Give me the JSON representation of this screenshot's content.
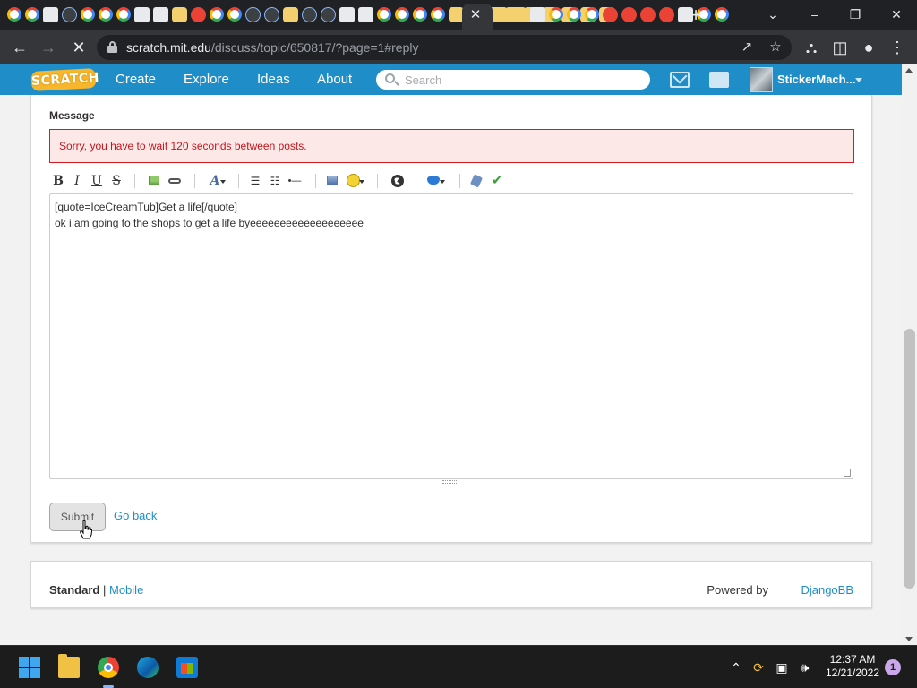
{
  "browser": {
    "tab_close_glyph": "✕",
    "new_tab_glyph": "+",
    "url_host": "scratch.mit.edu",
    "url_path": "/discuss/topic/650817/?page=1#reply",
    "tab_favicons": [
      "g",
      "g",
      "w",
      "b",
      "g",
      "g",
      "g",
      "w",
      "w",
      "y",
      "r",
      "g",
      "g",
      "b",
      "b",
      "y",
      "b",
      "b",
      "w",
      "w",
      "g",
      "g",
      "g",
      "g",
      "y",
      "y",
      "y",
      "y",
      "y",
      "y",
      "y",
      "y",
      "y"
    ],
    "tab_favicons_right": [
      "y",
      "y",
      "w",
      "g",
      "g",
      "g",
      "r",
      "r",
      "r",
      "r",
      "w",
      "g",
      "g"
    ]
  },
  "scratch_nav": {
    "logo_text": "SCRATCH",
    "links": [
      "Create",
      "Explore",
      "Ideas",
      "About"
    ],
    "search_placeholder": "Search",
    "username": "StickerMach..."
  },
  "form": {
    "message_label": "Message",
    "error_text": "Sorry, you have to wait 120 seconds between posts.",
    "toolbar": {
      "bold": "B",
      "italic": "I",
      "underline": "U",
      "strike": "S",
      "font_glyph": "A",
      "bullet_list_glyph": "☰",
      "numbered_list_glyph": "☷",
      "hr_glyph": "•—",
      "check_glyph": "✔"
    },
    "message_lines": [
      "[quote=IceCreamTub]Get a life[/quote]",
      "ok i am going to the shops to get a life byeeeeeeeeeeeeeeeeeee"
    ],
    "submit_label": "Submit",
    "go_back_label": "Go back"
  },
  "footer": {
    "standard_label": "Standard",
    "separator": "|",
    "mobile_label": "Mobile",
    "powered_by": "Powered by",
    "djangobb_label": "DjangoBB"
  },
  "taskbar": {
    "time": "12:37 AM",
    "date": "12/21/2022",
    "notification_count": "1"
  },
  "colors": {
    "scratch_blue": "#1f8ec8",
    "error_red": "#d9191f",
    "link_blue": "#1f8ec8"
  }
}
